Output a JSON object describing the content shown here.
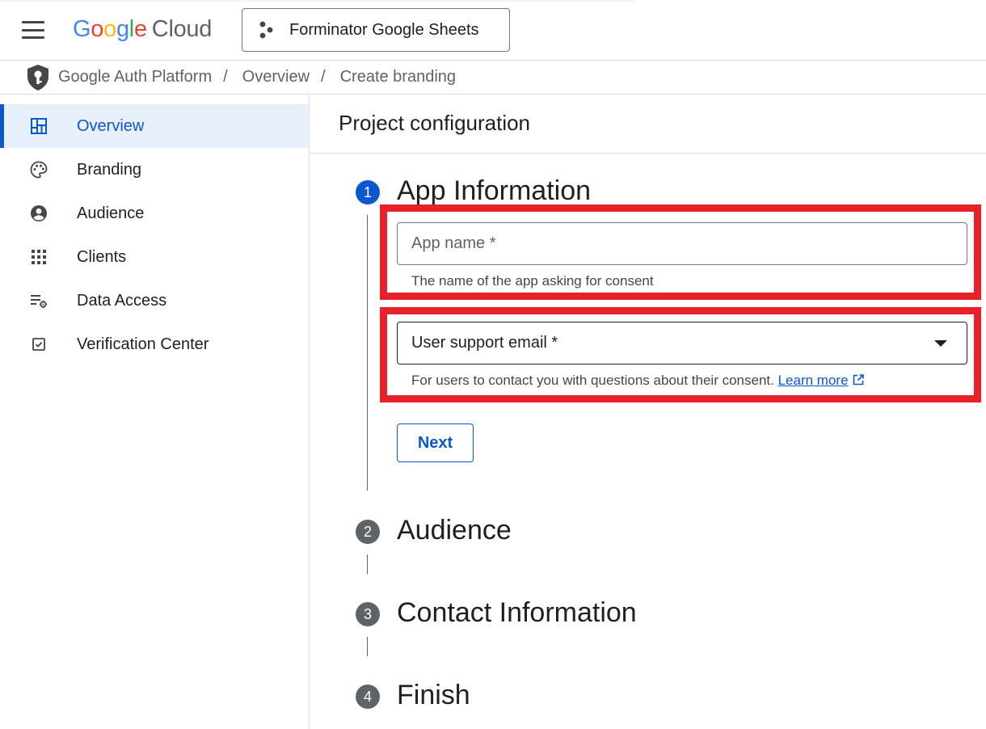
{
  "topbar": {
    "logo_letters": [
      "G",
      "o",
      "o",
      "g",
      "l",
      "e"
    ],
    "logo_suffix": "Cloud",
    "project_name": "Forminator Google Sheets"
  },
  "breadcrumb": {
    "items": [
      "Google Auth Platform",
      "Overview",
      "Create branding"
    ],
    "separator": "/"
  },
  "sidebar": {
    "items": [
      {
        "label": "Overview",
        "icon": "dashboard-icon",
        "active": true
      },
      {
        "label": "Branding",
        "icon": "palette-icon",
        "active": false
      },
      {
        "label": "Audience",
        "icon": "account-circle-icon",
        "active": false
      },
      {
        "label": "Clients",
        "icon": "apps-grid-icon",
        "active": false
      },
      {
        "label": "Data Access",
        "icon": "list-settings-icon",
        "active": false
      },
      {
        "label": "Verification Center",
        "icon": "checkbox-icon",
        "active": false
      }
    ]
  },
  "main": {
    "title": "Project configuration",
    "steps": [
      {
        "number": "1",
        "title": "App Information",
        "active": true
      },
      {
        "number": "2",
        "title": "Audience",
        "active": false
      },
      {
        "number": "3",
        "title": "Contact Information",
        "active": false
      },
      {
        "number": "4",
        "title": "Finish",
        "active": false
      }
    ],
    "app_name": {
      "placeholder": "App name *",
      "value": "",
      "helper": "The name of the app asking for consent"
    },
    "support_email": {
      "label": "User support email *",
      "helper": "For users to contact you with questions about their consent.",
      "link_text": "Learn more"
    },
    "next_label": "Next"
  },
  "colors": {
    "accent": "#0b57d0",
    "annotation": "#e8202a",
    "active_nav_bg": "#e8f0fe"
  }
}
